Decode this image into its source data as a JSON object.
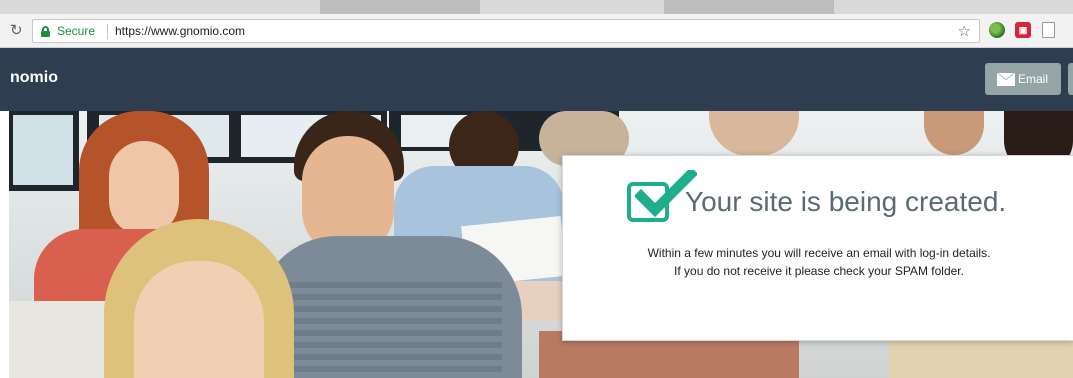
{
  "browser": {
    "secure_label": "Secure",
    "url": "https://www.gnomio.com",
    "icons": [
      "reload-icon",
      "lock-icon",
      "star-icon",
      "globe-extension-icon",
      "red-extension-icon",
      "document-extension-icon"
    ]
  },
  "header": {
    "brand": "nomio",
    "email_label": "Email",
    "background": "#2e3d4f",
    "button_color": "#95a5a6"
  },
  "notice": {
    "title": "Your site is being created.",
    "line1": "Within a few minutes you will receive an email with log-in details.",
    "line2": "If you do not receive it please check your SPAM folder.",
    "accent": "#1fae8c"
  }
}
